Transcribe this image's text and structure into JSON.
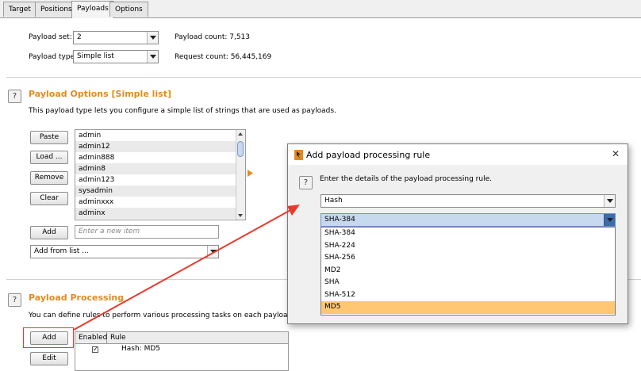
{
  "tabs": [
    {
      "label": "Target",
      "active": false
    },
    {
      "label": "Positions",
      "active": false
    },
    {
      "label": "Payloads",
      "active": true
    },
    {
      "label": "Options",
      "active": false
    }
  ],
  "payload_set": {
    "label": "Payload set:",
    "value": "2"
  },
  "payload_type": {
    "label": "Payload type:",
    "value": "Simple list"
  },
  "payload_count": "Payload count:  7,513",
  "request_count": "Request count:  56,445,169",
  "options_section": {
    "title": "Payload Options [Simple list]",
    "description": "This payload type lets you configure a simple list of strings that are used as payloads.",
    "buttons": {
      "paste": "Paste",
      "load": "Load ...",
      "remove": "Remove",
      "clear": "Clear",
      "add": "Add"
    },
    "items": [
      "admin",
      "admin12",
      "admin888",
      "admin8",
      "admin123",
      "sysadmin",
      "adminxxx",
      "adminx"
    ],
    "new_item_placeholder": "Enter a new item",
    "add_from_list": "Add from list ..."
  },
  "processing_section": {
    "title": "Payload Processing",
    "description": "You can define rules to perform various processing tasks on each payload before it is",
    "buttons": {
      "add": "Add",
      "edit": "Edit"
    },
    "columns": {
      "enabled": "Enabled",
      "rule": "Rule"
    },
    "rules": [
      {
        "enabled": true,
        "rule": "Hash: MD5"
      }
    ]
  },
  "dialog": {
    "title": "Add payload processing rule",
    "close": "✕",
    "prompt": "Enter the details of the payload processing rule.",
    "rule_type": "Hash",
    "algorithm": "SHA-384",
    "options": [
      "SHA-384",
      "SHA-224",
      "SHA-256",
      "MD2",
      "SHA",
      "SHA-512",
      "MD5"
    ],
    "selected_option": "MD5"
  },
  "colors": {
    "accent": "#e58a1f",
    "selection": "#ffc773",
    "arrow": "#e83a2c"
  }
}
